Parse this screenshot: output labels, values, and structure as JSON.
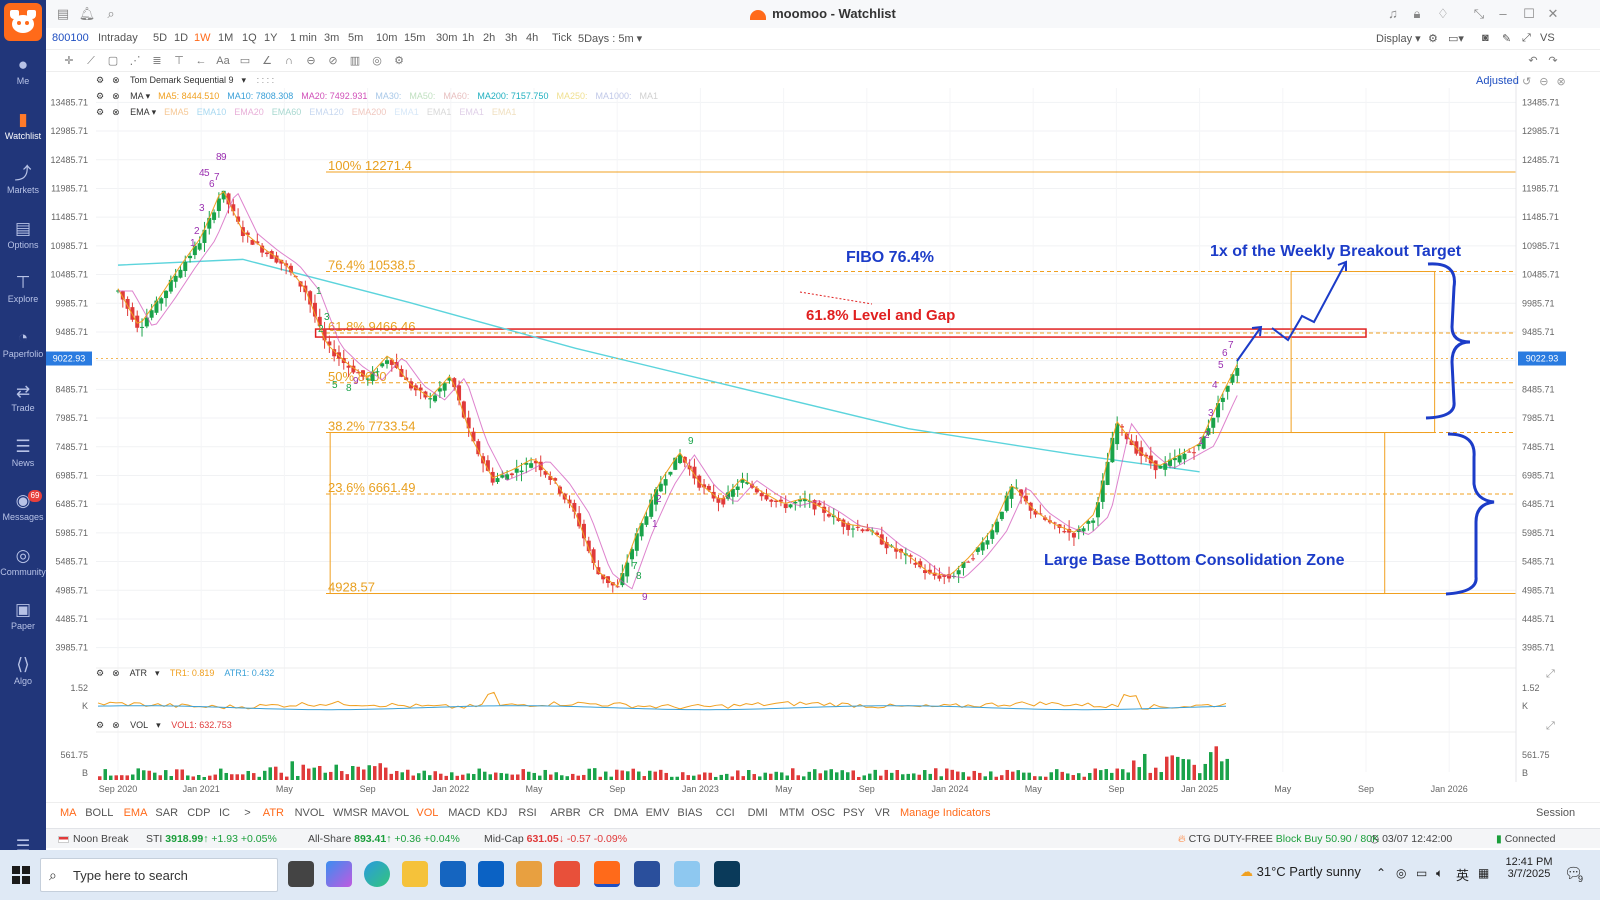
{
  "window": {
    "title": "moomoo - Watchlist"
  },
  "sidebar": {
    "items": [
      {
        "label": "Me",
        "icon": "person-icon"
      },
      {
        "label": "Watchlist",
        "icon": "watchlist-icon"
      },
      {
        "label": "Markets",
        "icon": "markets-icon"
      },
      {
        "label": "Options",
        "icon": "options-icon"
      },
      {
        "label": "Explore",
        "icon": "explore-icon"
      },
      {
        "label": "Paperfolio",
        "icon": "paperfolio-icon"
      },
      {
        "label": "Trade",
        "icon": "trade-icon"
      },
      {
        "label": "News",
        "icon": "news-icon"
      },
      {
        "label": "Messages",
        "icon": "messages-icon",
        "badge": "69"
      },
      {
        "label": "Community",
        "icon": "community-icon"
      },
      {
        "label": "Paper",
        "icon": "paper-icon"
      },
      {
        "label": "Algo",
        "icon": "algo-icon"
      }
    ]
  },
  "toolbar": {
    "symbol": "800100",
    "timeframes": [
      "Intraday",
      "5D",
      "1D",
      "1W",
      "1M",
      "1Q",
      "1Y",
      "1 min",
      "3m",
      "5m",
      "10m",
      "15m",
      "30m",
      "1h",
      "2h",
      "3h",
      "4h",
      "Tick",
      "5Days : 5m"
    ],
    "selected": "1W",
    "display_label": "Display",
    "vs_label": "VS",
    "adjusted_label": "Adjusted"
  },
  "indicators": {
    "td": {
      "name": "Tom Demark Sequential 9",
      "params": ": : : :"
    },
    "ma": [
      {
        "label": "MA",
        "color": "#333333"
      },
      {
        "label": "MA5:",
        "value": "8444.510",
        "color": "#f0a020"
      },
      {
        "label": "MA10:",
        "value": "7808.308",
        "color": "#3aa0d8"
      },
      {
        "label": "MA20:",
        "value": "7492.931",
        "color": "#d04fb8"
      },
      {
        "label": "MA30:",
        "value": "",
        "color": "#a8c8e8"
      },
      {
        "label": "MA50:",
        "value": "",
        "color": "#c0e0c0"
      },
      {
        "label": "MA60:",
        "value": "",
        "color": "#e8c0c0"
      },
      {
        "label": "MA200:",
        "value": "7157.750",
        "color": "#20b0c0"
      },
      {
        "label": "MA250:",
        "value": "",
        "color": "#f0e090"
      },
      {
        "label": "MA1000:",
        "value": "",
        "color": "#c0c8e8"
      },
      {
        "label": "MA1",
        "value": "",
        "color": "#d0d0d0"
      }
    ],
    "ema": [
      {
        "label": "EMA",
        "color": "#333333"
      },
      {
        "label": "EMA5",
        "color": "#f5c896"
      },
      {
        "label": "EMA10",
        "color": "#a8d8f0"
      },
      {
        "label": "EMA20",
        "color": "#e8b0d8"
      },
      {
        "label": "EMA60",
        "color": "#a8d8d0"
      },
      {
        "label": "EMA120",
        "color": "#c8d8f0"
      },
      {
        "label": "EMA200",
        "color": "#f0c8c0"
      },
      {
        "label": "EMA1",
        "color": "#d8e8f8"
      },
      {
        "label": "EMA1",
        "color": "#d8d8d8"
      },
      {
        "label": "EMA1",
        "color": "#e0d0e8"
      },
      {
        "label": "EMA1",
        "color": "#f0e0c0"
      }
    ],
    "atr": {
      "name": "ATR",
      "tr1": "TR1: 0.819",
      "atr1": "ATR1: 0.432"
    },
    "vol": {
      "name": "VOL",
      "vol1": "VOL1: 632.753"
    }
  },
  "chart_data": {
    "type": "line",
    "title": "",
    "xlabel": "",
    "ylabel": "",
    "x_ticks": [
      "Sep 2020",
      "Jan 2021",
      "May",
      "Sep",
      "Jan 2022",
      "May",
      "Sep",
      "Jan 2023",
      "May",
      "Sep",
      "Jan 2024",
      "May",
      "Sep",
      "Jan 2025",
      "May",
      "Sep",
      "Jan 2026"
    ],
    "y_ticks": [
      "13485.71",
      "12985.71",
      "12485.71",
      "11985.71",
      "11485.71",
      "10985.71",
      "10485.71",
      "9985.71",
      "9485.71",
      "8985.71",
      "8485.71",
      "7985.71",
      "7485.71",
      "6985.71",
      "6485.71",
      "5985.71",
      "5485.71",
      "4985.71",
      "4485.71",
      "3985.71"
    ],
    "ylim": [
      3735.71,
      13735.71
    ],
    "current_price": "9022.93",
    "series": [
      {
        "name": "",
        "color": "#e03a3a",
        "points": [
          [
            "Sep 2020",
            10200
          ],
          [
            "Oct 2020",
            9550
          ],
          [
            "Nov 2020",
            10050
          ],
          [
            "Dec 2020",
            10600
          ],
          [
            "Jan 2021",
            11100
          ],
          [
            "Feb 2021",
            11950
          ],
          [
            "Mar 2021",
            11200
          ],
          [
            "Apr 2021",
            10900
          ],
          [
            "May 2021",
            10650
          ],
          [
            "Jun 2021",
            10200
          ],
          [
            "Jul 2021",
            9250
          ],
          [
            "Aug 2021",
            8900
          ],
          [
            "Sep 2021",
            8650
          ],
          [
            "Oct 2021",
            9050
          ],
          [
            "Nov 2021",
            8550
          ],
          [
            "Dec 2021",
            8300
          ],
          [
            "Jan 2022",
            8700
          ],
          [
            "Feb 2022",
            7600
          ],
          [
            "Mar 2022",
            6900
          ],
          [
            "Apr 2022",
            7050
          ],
          [
            "May 2022",
            7250
          ],
          [
            "Jun 2022",
            6850
          ],
          [
            "Jul 2022",
            6300
          ],
          [
            "Aug 2022",
            5300
          ],
          [
            "Sep 2022",
            5000
          ],
          [
            "Oct 2022",
            6000
          ],
          [
            "Nov 2022",
            6800
          ],
          [
            "Dec 2022",
            7350
          ],
          [
            "Jan 2023",
            6800
          ],
          [
            "Feb 2023",
            6500
          ],
          [
            "Mar 2023",
            6900
          ],
          [
            "Apr 2023",
            6650
          ],
          [
            "May 2023",
            6450
          ],
          [
            "Jun 2023",
            6550
          ],
          [
            "Jul 2023",
            6350
          ],
          [
            "Aug 2023",
            6100
          ],
          [
            "Sep 2023",
            6050
          ],
          [
            "Oct 2023",
            5750
          ],
          [
            "Nov 2023",
            5550
          ],
          [
            "Dec 2023",
            5250
          ],
          [
            "Jan 2024",
            5200
          ],
          [
            "Feb 2024",
            5550
          ],
          [
            "Mar 2024",
            6000
          ],
          [
            "Apr 2024",
            6800
          ],
          [
            "May 2024",
            6350
          ],
          [
            "Jun 2024",
            6100
          ],
          [
            "Jul 2024",
            5950
          ],
          [
            "Aug 2024",
            6300
          ],
          [
            "Sep 2024",
            7900
          ],
          [
            "Oct 2024",
            7400
          ],
          [
            "Nov 2024",
            7100
          ],
          [
            "Dec 2024",
            7300
          ],
          [
            "Jan 2025",
            7500
          ],
          [
            "Feb 2025",
            8300
          ],
          [
            "Mar 2025",
            9022.93
          ]
        ]
      }
    ],
    "fibonacci": [
      {
        "label": "100% 12271.4",
        "value": 12271.4
      },
      {
        "label": "76.4% 10538.5",
        "value": 10538.5
      },
      {
        "label": "61.8% 9466.46",
        "value": 9466.46
      },
      {
        "label": "50% 8600",
        "value": 8600
      },
      {
        "label": "38.2% 7733.54",
        "value": 7733.54
      },
      {
        "label": "23.6% 6661.49",
        "value": 6661.49
      },
      {
        "label": "4928.57",
        "value": 4928.57
      }
    ],
    "annotations": [
      {
        "text": "FIBO 76.4%",
        "color": "#1c3cc8"
      },
      {
        "text": "1x of the Weekly Breakout Target",
        "color": "#1c3cc8"
      },
      {
        "text": "61.8% Level and Gap",
        "color": "#e02020"
      },
      {
        "text": "Large Base Bottom Consolidation Zone",
        "color": "#1c3cc8"
      }
    ],
    "atr_axis": [
      "1.52",
      "K"
    ],
    "vol_axis": [
      "561.75",
      "B"
    ]
  },
  "indicator_tabs": [
    "MA",
    "BOLL",
    "EMA",
    "SAR",
    "CDP",
    "IC",
    ">",
    "ATR",
    "NVOL",
    "WMSR",
    "MAVOL",
    "VOL",
    "MACD",
    "KDJ",
    "RSI",
    "ARBR",
    "CR",
    "DMA",
    "EMV",
    "BIAS",
    "CCI",
    "DMI",
    "MTM",
    "OSC",
    "PSY",
    "VR",
    "Manage Indicators"
  ],
  "session_label": "Session",
  "ticker": {
    "market_status": "Noon Break",
    "sti": {
      "name": "STI",
      "value": "3918.99↑",
      "change": "+1.93",
      "pct": "+0.05%"
    },
    "allshare": {
      "name": "All-Share",
      "value": "893.41↑",
      "change": "+0.36",
      "pct": "+0.04%"
    },
    "midcap": {
      "name": "Mid-Cap",
      "value": "631.05↓",
      "change": "-0.57",
      "pct": "-0.09%"
    },
    "news": "CTG DUTY-FREE",
    "news_detail": "Block Buy 50.90 / 80K",
    "datetime": "03/07 12:42:00",
    "connection": "Connected"
  },
  "taskbar": {
    "search_placeholder": "Type here to search",
    "weather": "31°C  Partly sunny",
    "lang": "英",
    "time": "12:41 PM",
    "date": "3/7/2025",
    "notif_count": "9"
  }
}
